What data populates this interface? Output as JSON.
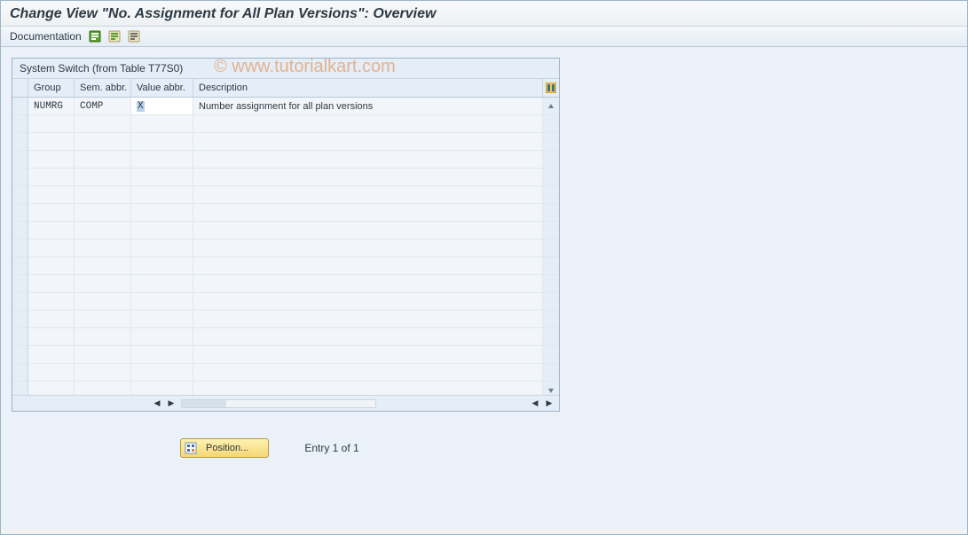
{
  "title": "Change View \"No. Assignment for All Plan Versions\": Overview",
  "toolbar": {
    "documentation": "Documentation"
  },
  "watermark": "© www.tutorialkart.com",
  "grid": {
    "title": "System Switch (from Table T77S0)",
    "columns": {
      "group": "Group",
      "sem": "Sem. abbr.",
      "value": "Value abbr.",
      "desc": "Description"
    },
    "rows": [
      {
        "group": "NUMRG",
        "sem": "COMP",
        "value": "X",
        "desc": "Number assignment for all plan versions"
      }
    ]
  },
  "position_button": "Position...",
  "entry_status": "Entry 1 of 1"
}
